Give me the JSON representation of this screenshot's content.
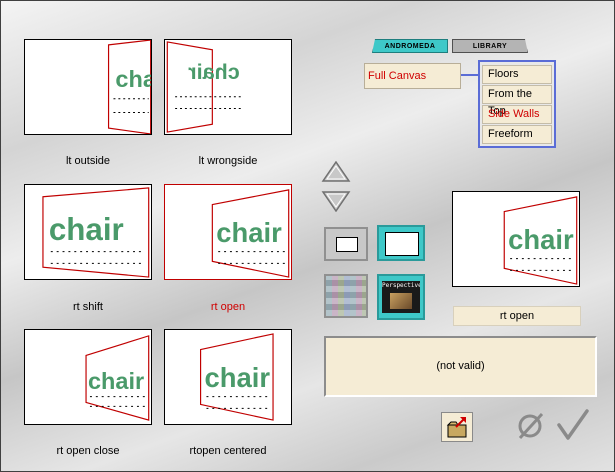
{
  "tabs": [
    {
      "label": "ANDROMEDA",
      "active": true
    },
    {
      "label": "LIBRARY",
      "active": false
    }
  ],
  "canvas_option": "Full Canvas",
  "menu": {
    "items": [
      "Floors",
      "From the Top",
      "Side Walls",
      "Freeform"
    ],
    "active_index": 2
  },
  "thumbnails": [
    {
      "caption": "lt outside",
      "selected": false
    },
    {
      "caption": "lt wrongside",
      "selected": false
    },
    {
      "caption": "rt shift",
      "selected": false
    },
    {
      "caption": "rt open",
      "selected": true
    },
    {
      "caption": "rt open close",
      "selected": false
    },
    {
      "caption": "rtopen centered",
      "selected": false
    }
  ],
  "thumbnail_word": "chair",
  "tools": {
    "perspective_label": "Perspective"
  },
  "preview": {
    "name": "rt open",
    "word": "chair"
  },
  "status_text": "(not valid)",
  "colors": {
    "accent_red": "#d00000",
    "chair_green": "#4a9a6a",
    "menu_border": "#5a6cd6",
    "field_bg": "#f5ecd5",
    "tab_active": "#3ec8c8"
  },
  "icons": {
    "open_file": "folder-open-icon",
    "cancel": "cancel-icon",
    "ok": "checkmark-icon"
  }
}
